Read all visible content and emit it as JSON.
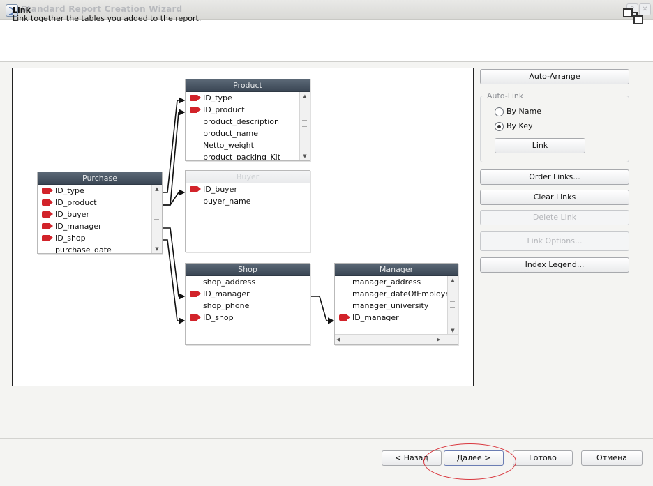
{
  "window": {
    "title": "Standard Report Creation Wizard"
  },
  "header": {
    "title": "Link",
    "subtitle": "Link together the tables you added to the report."
  },
  "tables": {
    "product": {
      "title": "Product",
      "fields": [
        {
          "name": "ID_type",
          "key": true
        },
        {
          "name": "ID_product",
          "key": true
        },
        {
          "name": "product_description",
          "key": false
        },
        {
          "name": "product_name",
          "key": false
        },
        {
          "name": "Netto_weight",
          "key": false
        },
        {
          "name": "product_packing_Kit",
          "key": false
        }
      ]
    },
    "purchase": {
      "title": "Purchase",
      "fields": [
        {
          "name": "ID_type",
          "key": true
        },
        {
          "name": "ID_product",
          "key": true
        },
        {
          "name": "ID_buyer",
          "key": true
        },
        {
          "name": "ID_manager",
          "key": true
        },
        {
          "name": "ID_shop",
          "key": true
        },
        {
          "name": "purchase_date",
          "key": false
        }
      ]
    },
    "buyer": {
      "title": "Buyer",
      "fields": [
        {
          "name": "ID_buyer",
          "key": true
        },
        {
          "name": "buyer_name",
          "key": false
        }
      ]
    },
    "shop": {
      "title": "Shop",
      "fields": [
        {
          "name": "shop_address",
          "key": false
        },
        {
          "name": "ID_manager",
          "key": true
        },
        {
          "name": "shop_phone",
          "key": false
        },
        {
          "name": "ID_shop",
          "key": true
        }
      ]
    },
    "manager": {
      "title": "Manager",
      "fields": [
        {
          "name": "manager_address",
          "key": false
        },
        {
          "name": "manager_dateOfEmployment",
          "key": false
        },
        {
          "name": "manager_university",
          "key": false
        },
        {
          "name": "ID_manager",
          "key": true
        }
      ]
    }
  },
  "right_panel": {
    "auto_arrange": "Auto-Arrange",
    "autolink_group": "Auto-Link",
    "by_name": "By Name",
    "by_key": "By Key",
    "selected_mode": "by_key",
    "link": "Link",
    "order_links": "Order Links...",
    "clear_links": "Clear Links",
    "delete_link": "Delete Link",
    "link_options": "Link Options...",
    "index_legend": "Index Legend..."
  },
  "footer": {
    "back": "< Назад",
    "next": "Далее >",
    "finish": "Готово",
    "cancel": "Отмена"
  },
  "colors": {
    "key_icon": "#d2232a",
    "table_header": "#46525f",
    "highlight": "#d9383f",
    "guide_line": "#f2e85a"
  }
}
